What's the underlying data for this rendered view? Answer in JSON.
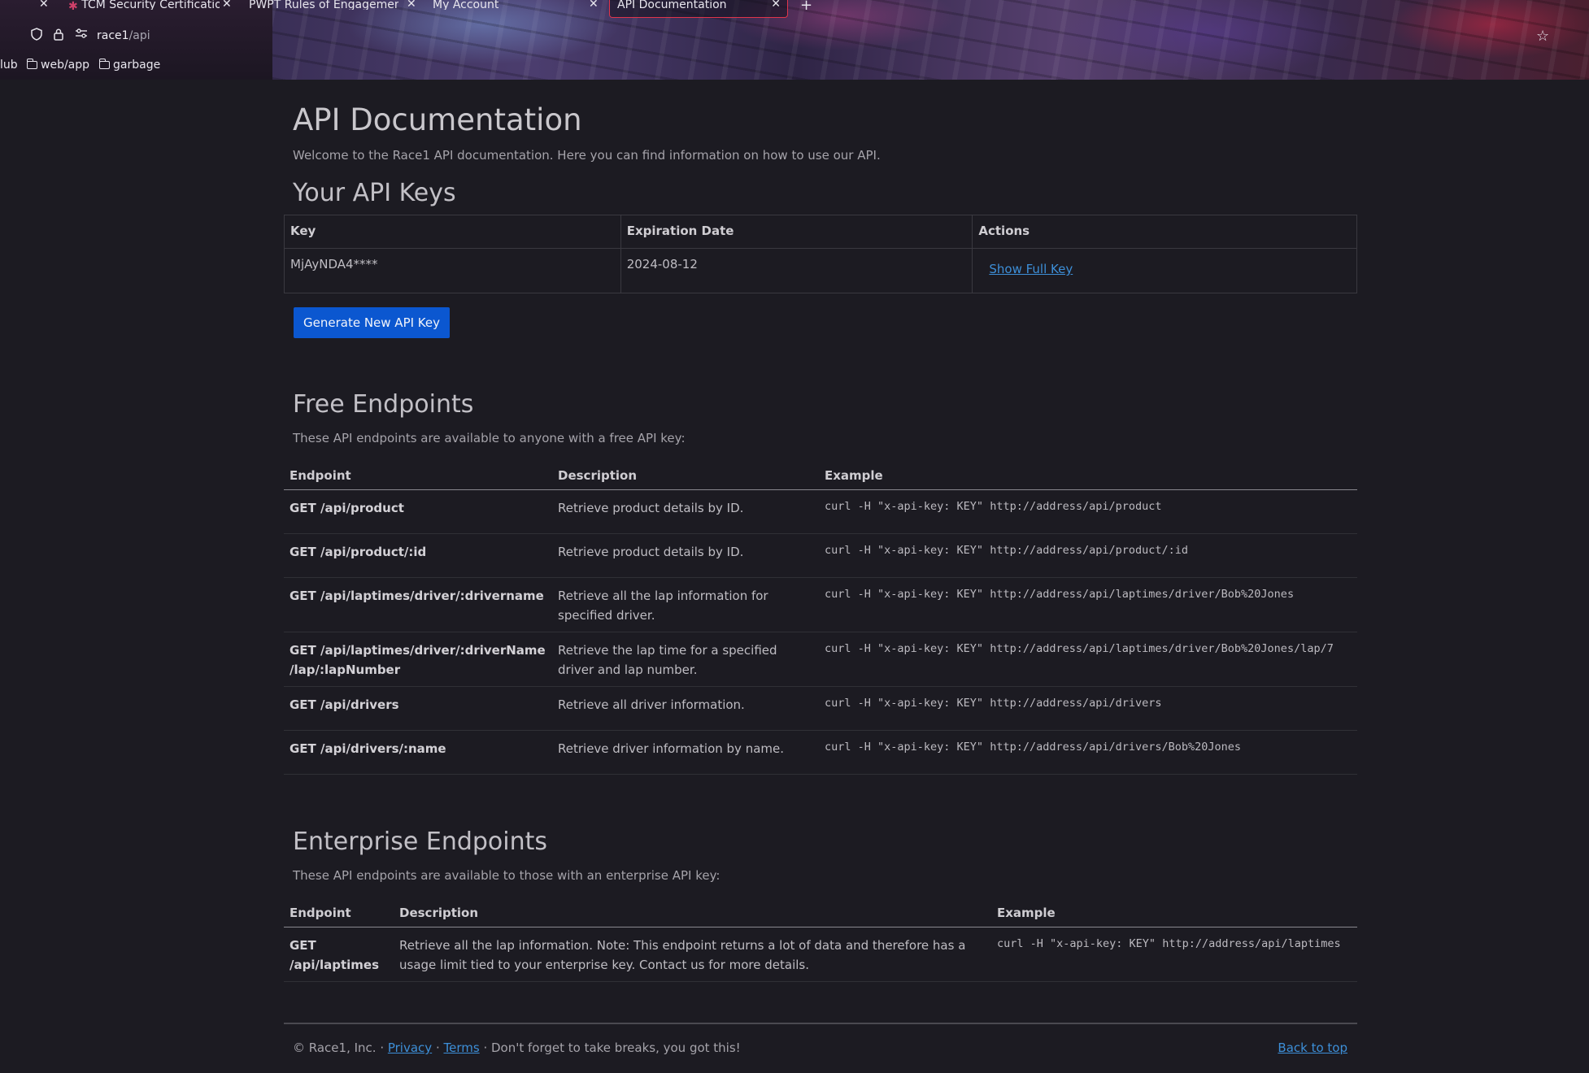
{
  "browser": {
    "tabs": [
      {
        "label": "TCM Security Certification"
      },
      {
        "label": "PWPT Rules of Engagement"
      },
      {
        "label": "My Account"
      }
    ],
    "active_tab": {
      "label": "API Documentation"
    },
    "url": {
      "host": "race1",
      "path": "/api"
    },
    "bookmarks": [
      {
        "label": "lub"
      },
      {
        "label": "web/app"
      },
      {
        "label": "garbage"
      }
    ]
  },
  "page": {
    "title": "API Documentation",
    "intro": "Welcome to the Race1 API documentation. Here you can find information on how to use our API.",
    "keys": {
      "heading": "Your API Keys",
      "columns": [
        "Key",
        "Expiration Date",
        "Actions"
      ],
      "rows": [
        {
          "key": "MjAyNDA4****",
          "expiration": "2024-08-12",
          "action": "Show Full Key"
        }
      ],
      "generate_label": "Generate New API Key"
    },
    "free": {
      "heading": "Free Endpoints",
      "description": "These API endpoints are available to anyone with a free API key:",
      "columns": [
        "Endpoint",
        "Description",
        "Example"
      ],
      "rows": [
        {
          "endpoint": "GET /api/product",
          "description": "Retrieve product details by ID.",
          "example": "curl -H \"x-api-key: KEY\" http://address/api/product"
        },
        {
          "endpoint": "GET /api/product/:id",
          "description": "Retrieve product details by ID.",
          "example": "curl -H \"x-api-key: KEY\" http://address/api/product/:id"
        },
        {
          "endpoint": "GET /api/laptimes/driver/:drivername",
          "description": "Retrieve all the lap information for specified driver.",
          "example": "curl -H \"x-api-key: KEY\" http://address/api/laptimes/driver/Bob%20Jones"
        },
        {
          "endpoint": "GET /api/laptimes/driver/:driverName /lap/:lapNumber",
          "description": "Retrieve the lap time for a specified driver and lap number.",
          "example": "curl -H \"x-api-key: KEY\" http://address/api/laptimes/driver/Bob%20Jones/lap/7"
        },
        {
          "endpoint": "GET /api/drivers",
          "description": "Retrieve all driver information.",
          "example": "curl -H \"x-api-key: KEY\" http://address/api/drivers"
        },
        {
          "endpoint": "GET /api/drivers/:name",
          "description": "Retrieve driver information by name.",
          "example": "curl -H \"x-api-key: KEY\" http://address/api/drivers/Bob%20Jones"
        }
      ]
    },
    "enterprise": {
      "heading": "Enterprise Endpoints",
      "description": "These API endpoints are available to those with an enterprise API key:",
      "columns": [
        "Endpoint",
        "Description",
        "Example"
      ],
      "rows": [
        {
          "endpoint": "GET /api/laptimes",
          "description": "Retrieve all the lap information. Note: This endpoint returns a lot of data and therefore has a usage limit tied to your enterprise key. Contact us for more details.",
          "example": "curl -H \"x-api-key: KEY\" http://address/api/laptimes"
        }
      ]
    },
    "footer": {
      "copyright": "© Race1, Inc. · ",
      "privacy": "Privacy",
      "sep": " · ",
      "terms": "Terms",
      "tagline": " · Don't forget to take breaks, you got this!",
      "back_to_top": "Back to top"
    }
  },
  "colors": {
    "background": "#1c1b22",
    "primary_button": "#0b57d0",
    "link": "#3d8fd8",
    "active_tab_border": "#e0354b"
  }
}
